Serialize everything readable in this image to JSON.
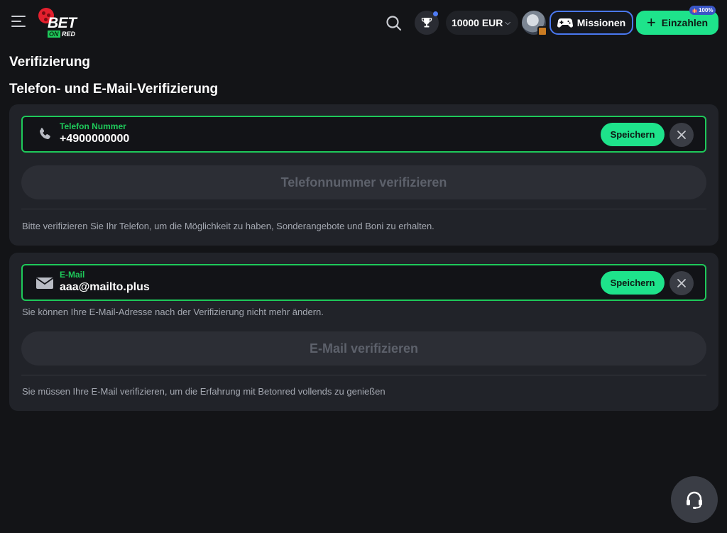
{
  "header": {
    "menu_icon": "hamburger-icon",
    "logo": {
      "bet": "BET",
      "on": "ON",
      "red": "RED"
    },
    "search_icon": "search-icon",
    "trophy_icon": "trophy-icon",
    "balance": "10000 EUR",
    "balance_chevron": "⌵",
    "missions_label": "Missionen",
    "deposit_label": "Einzahlen",
    "deposit_badge": "100%"
  },
  "page": {
    "title": "Verifizierung",
    "section_title": "Telefon- und E-Mail-Verifizierung"
  },
  "phone": {
    "icon": "phone-icon",
    "label": "Telefon Nummer",
    "value": "+4900000000",
    "save_label": "Speichern",
    "verify_label": "Telefonnummer verifizieren",
    "hint": "Bitte verifizieren Sie Ihr Telefon, um die Möglichkeit zu haben, Sonderangebote und Boni zu erhalten."
  },
  "email": {
    "icon": "mail-icon",
    "label": "E-Mail",
    "value": "aaa@mailto.plus",
    "save_label": "Speichern",
    "note": "Sie können Ihre E-Mail-Adresse nach der Verifizierung nicht mehr ändern.",
    "verify_label": "E-Mail verifizieren",
    "hint": "Sie müssen Ihre E-Mail verifizieren, um die Erfahrung mit Betonred vollends zu genießen"
  },
  "colors": {
    "accent_green": "#1ee38b",
    "field_border": "#1ec95a",
    "missions_border": "#4a78f0",
    "background": "#131417",
    "card": "#212329"
  }
}
